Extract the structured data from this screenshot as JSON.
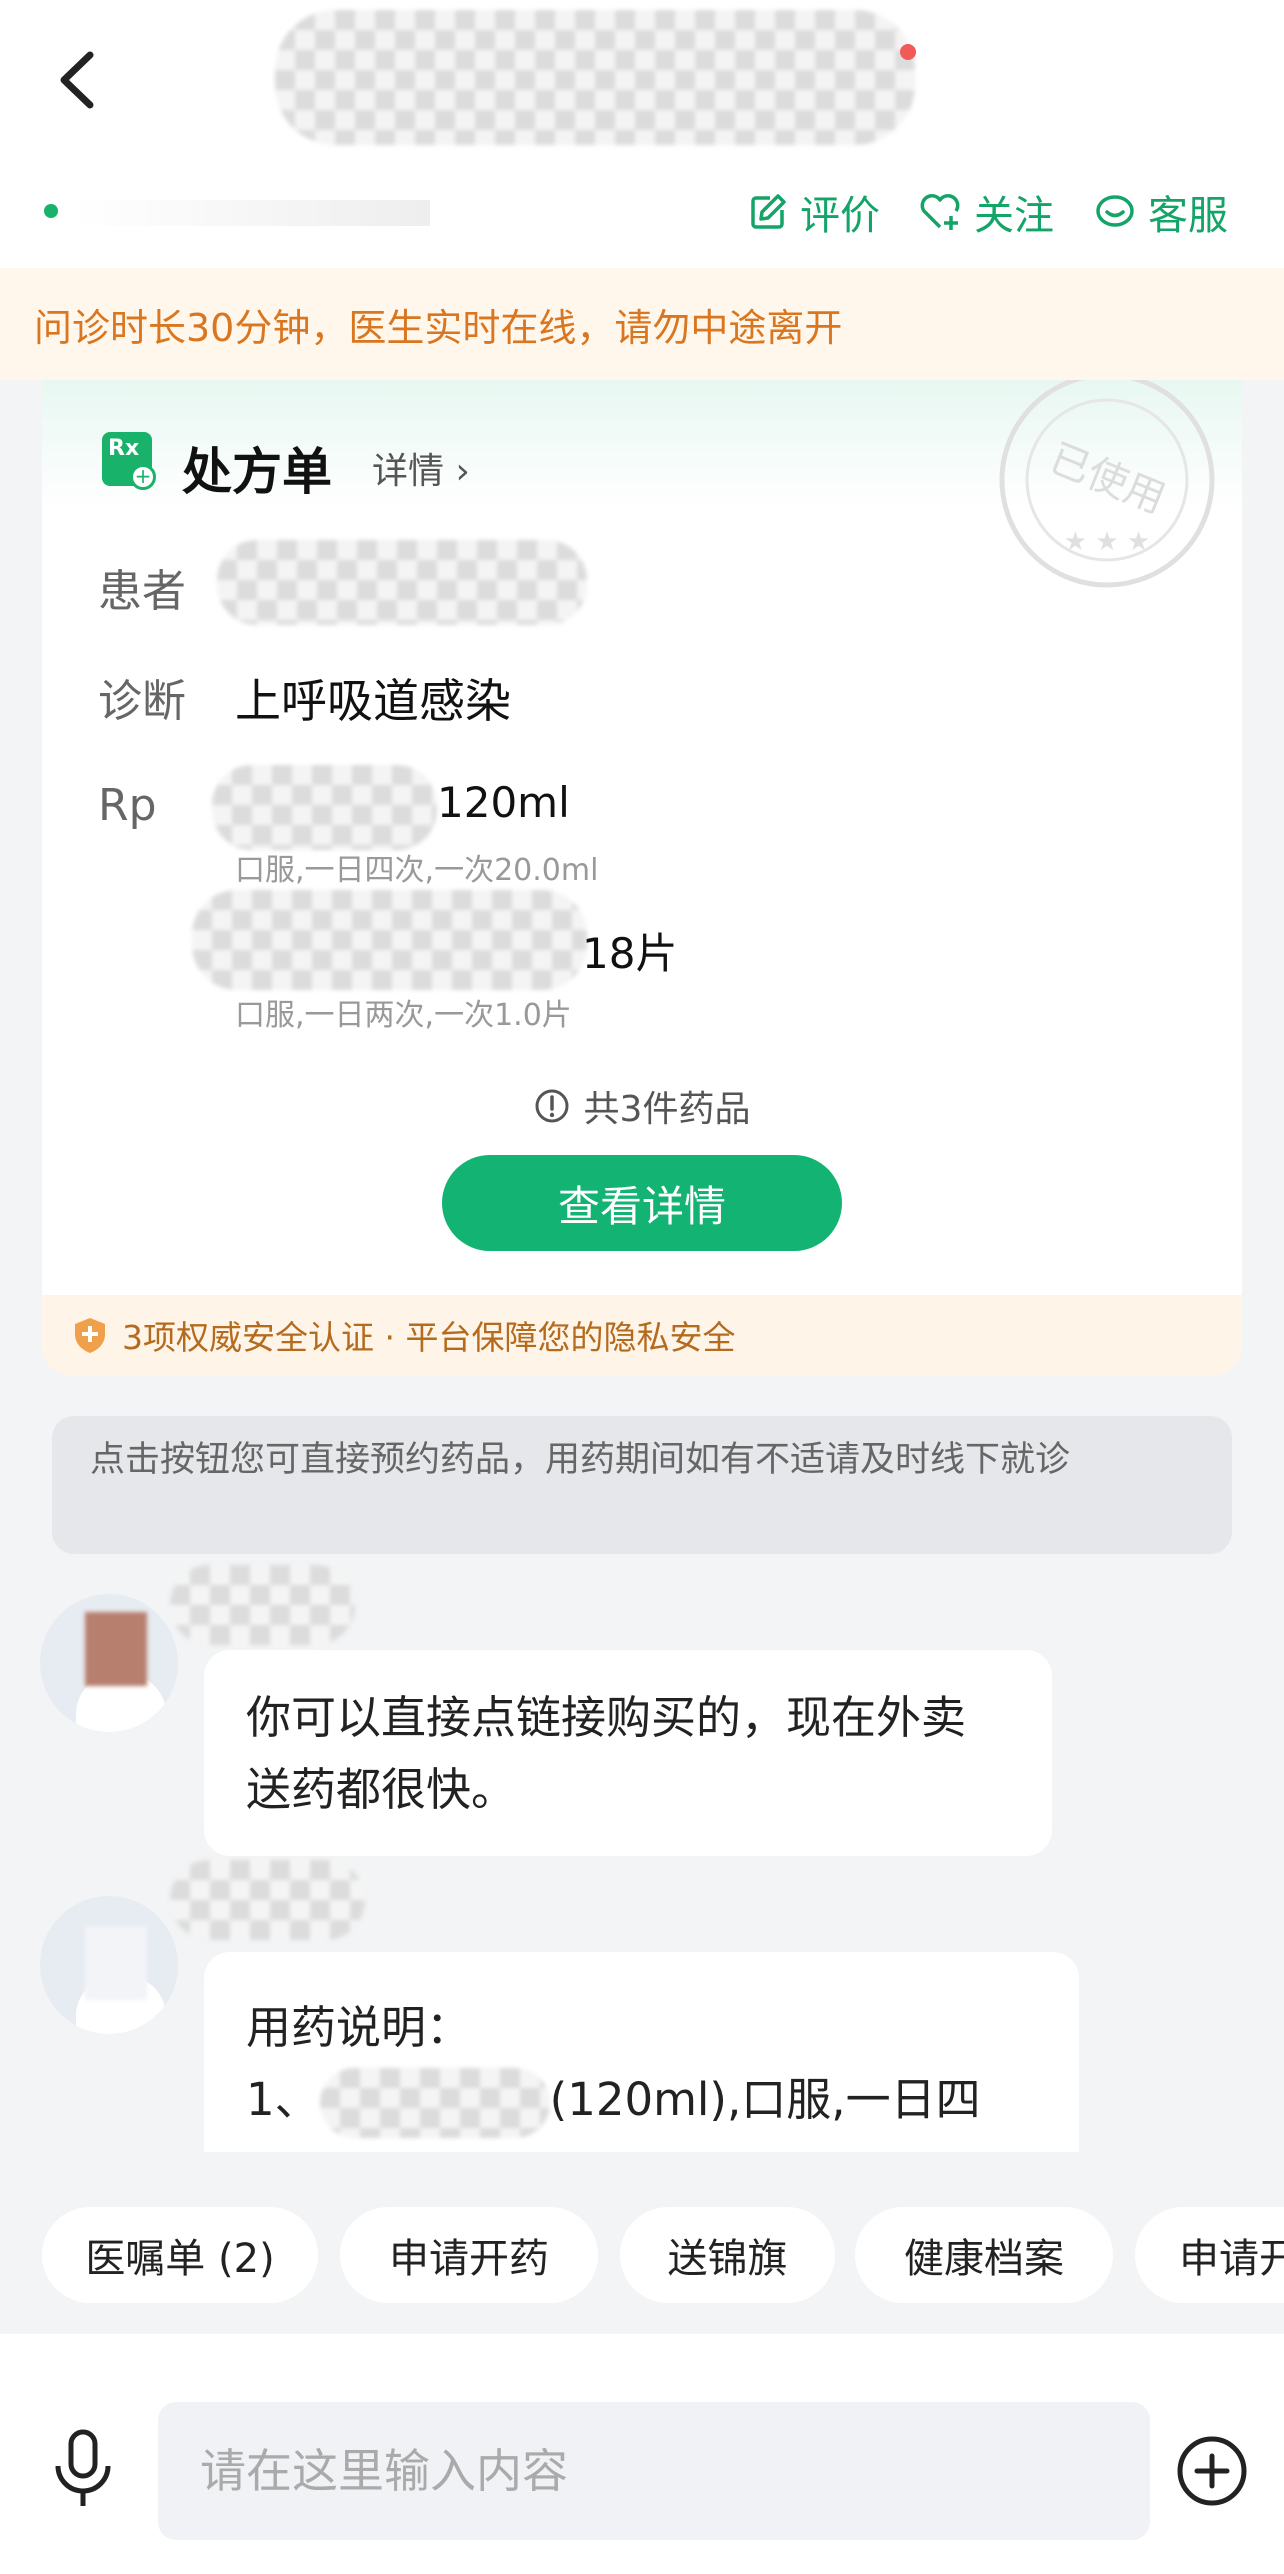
{
  "header": {
    "actions": {
      "rate": "评价",
      "follow": "关注",
      "service": "客服"
    }
  },
  "notice": "问诊时长30分钟，医生实时在线，请勿中途离开",
  "prescription": {
    "title": "处方单",
    "detail_link": "详情 ›",
    "stamp_text": "已使用",
    "labels": {
      "patient": "患者",
      "diagnosis": "诊断",
      "rp": "Rp"
    },
    "diagnosis": "上呼吸道感染",
    "meds": [
      {
        "name_suffix": "120ml",
        "usage": "口服,一日四次,一次20.0ml"
      },
      {
        "name_suffix": "18片",
        "usage": "口服,一日两次,一次1.0片"
      }
    ],
    "count_text": "共3件药品",
    "view_button": "查看详情",
    "security_text": "3项权威安全认证 · 平台保障您的隐私安全"
  },
  "tip": "点击按钮您可直接预约药品，用药期间如有不适请及时线下就诊",
  "messages": [
    {
      "text": "你可以直接点链接购买的，现在外卖送药都很快。"
    },
    {
      "line1": "用药说明：",
      "line2_prefix": "1、",
      "line2_suffix": "(120ml),口服,一日四"
    }
  ],
  "chips": [
    "医嘱单 (2)",
    "申请开药",
    "送锦旗",
    "健康档案",
    "申请开"
  ],
  "input": {
    "placeholder": "请在这里输入内容"
  },
  "colors": {
    "brand_green": "#12b373",
    "notice_orange": "#d9761f",
    "background": "#f2f4f5"
  }
}
